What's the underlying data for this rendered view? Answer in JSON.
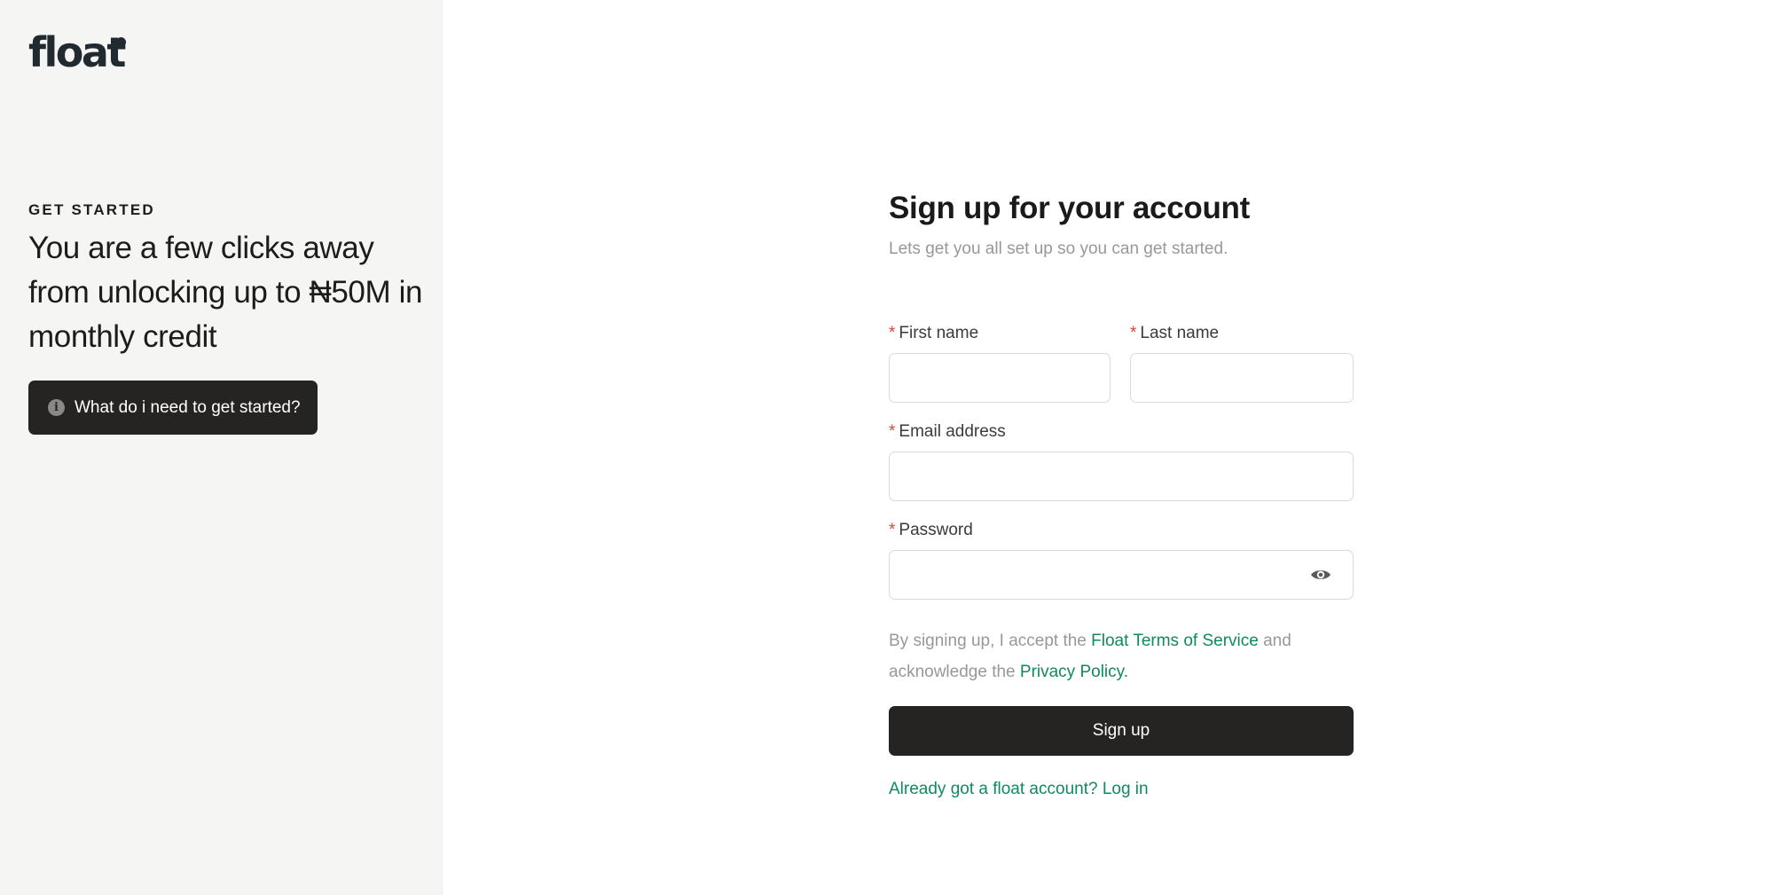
{
  "brand": {
    "logo_text": "float"
  },
  "sidebar": {
    "eyebrow": "GET STARTED",
    "headline": "You are a few clicks away from unlocking up to ₦50M in monthly credit",
    "help_button_label": "What do i need to get started?",
    "help_icon": "info-icon"
  },
  "form": {
    "title": "Sign up for your account",
    "subtitle": "Lets get you all set up so you can get started.",
    "required_mark": "*",
    "first_name": {
      "label": "First name",
      "value": ""
    },
    "last_name": {
      "label": "Last name",
      "value": ""
    },
    "email": {
      "label": "Email address",
      "value": ""
    },
    "password": {
      "label": "Password",
      "value": "",
      "toggle_icon": "eye-icon"
    },
    "terms": {
      "prefix": "By signing up, I accept the",
      "terms_link": "Float Terms of Service",
      "middle": "and acknowledge the",
      "privacy_link": "Privacy Policy."
    },
    "submit_label": "Sign up",
    "login_prompt": "Already got a float account? Log in"
  },
  "colors": {
    "accent": "#0f8a5f",
    "button": "#262423",
    "sidebar_bg": "#f5f5f3",
    "required": "#e5413a"
  }
}
